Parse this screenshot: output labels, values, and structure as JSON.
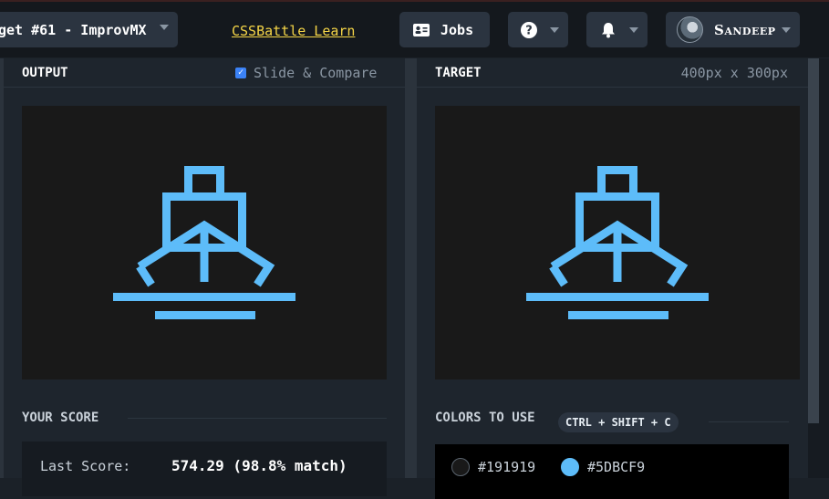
{
  "header": {
    "target_title": "get #61 - ImprovMX",
    "learn_link": "CSSBattle Learn",
    "jobs_label": "Jobs",
    "user_name": "Sandeep"
  },
  "output_panel": {
    "title": "OUTPUT",
    "slide_compare_label": "Slide & Compare",
    "slide_compare_checked": true
  },
  "target_panel": {
    "title": "TARGET",
    "dimensions": "400px x 300px"
  },
  "score": {
    "section_title": "YOUR SCORE",
    "last_score_label": "Last Score:",
    "last_score_value": "574.29 (98.8% match)"
  },
  "colors": {
    "section_title": "COLORS TO USE",
    "shortcut": "CTRL + SHIFT + C",
    "items": [
      {
        "hex": "#191919",
        "label": "#191919"
      },
      {
        "hex": "#5DBCF9",
        "label": "#5DBCF9"
      }
    ]
  },
  "design_colors": {
    "background": "#191919",
    "ship": "#5DBCF9",
    "link": "#F5D547"
  },
  "icons": [
    "chevron-down-icon",
    "id-card-icon",
    "help-icon",
    "bell-icon",
    "avatar",
    "checkbox-icon",
    "ship-icon"
  ]
}
